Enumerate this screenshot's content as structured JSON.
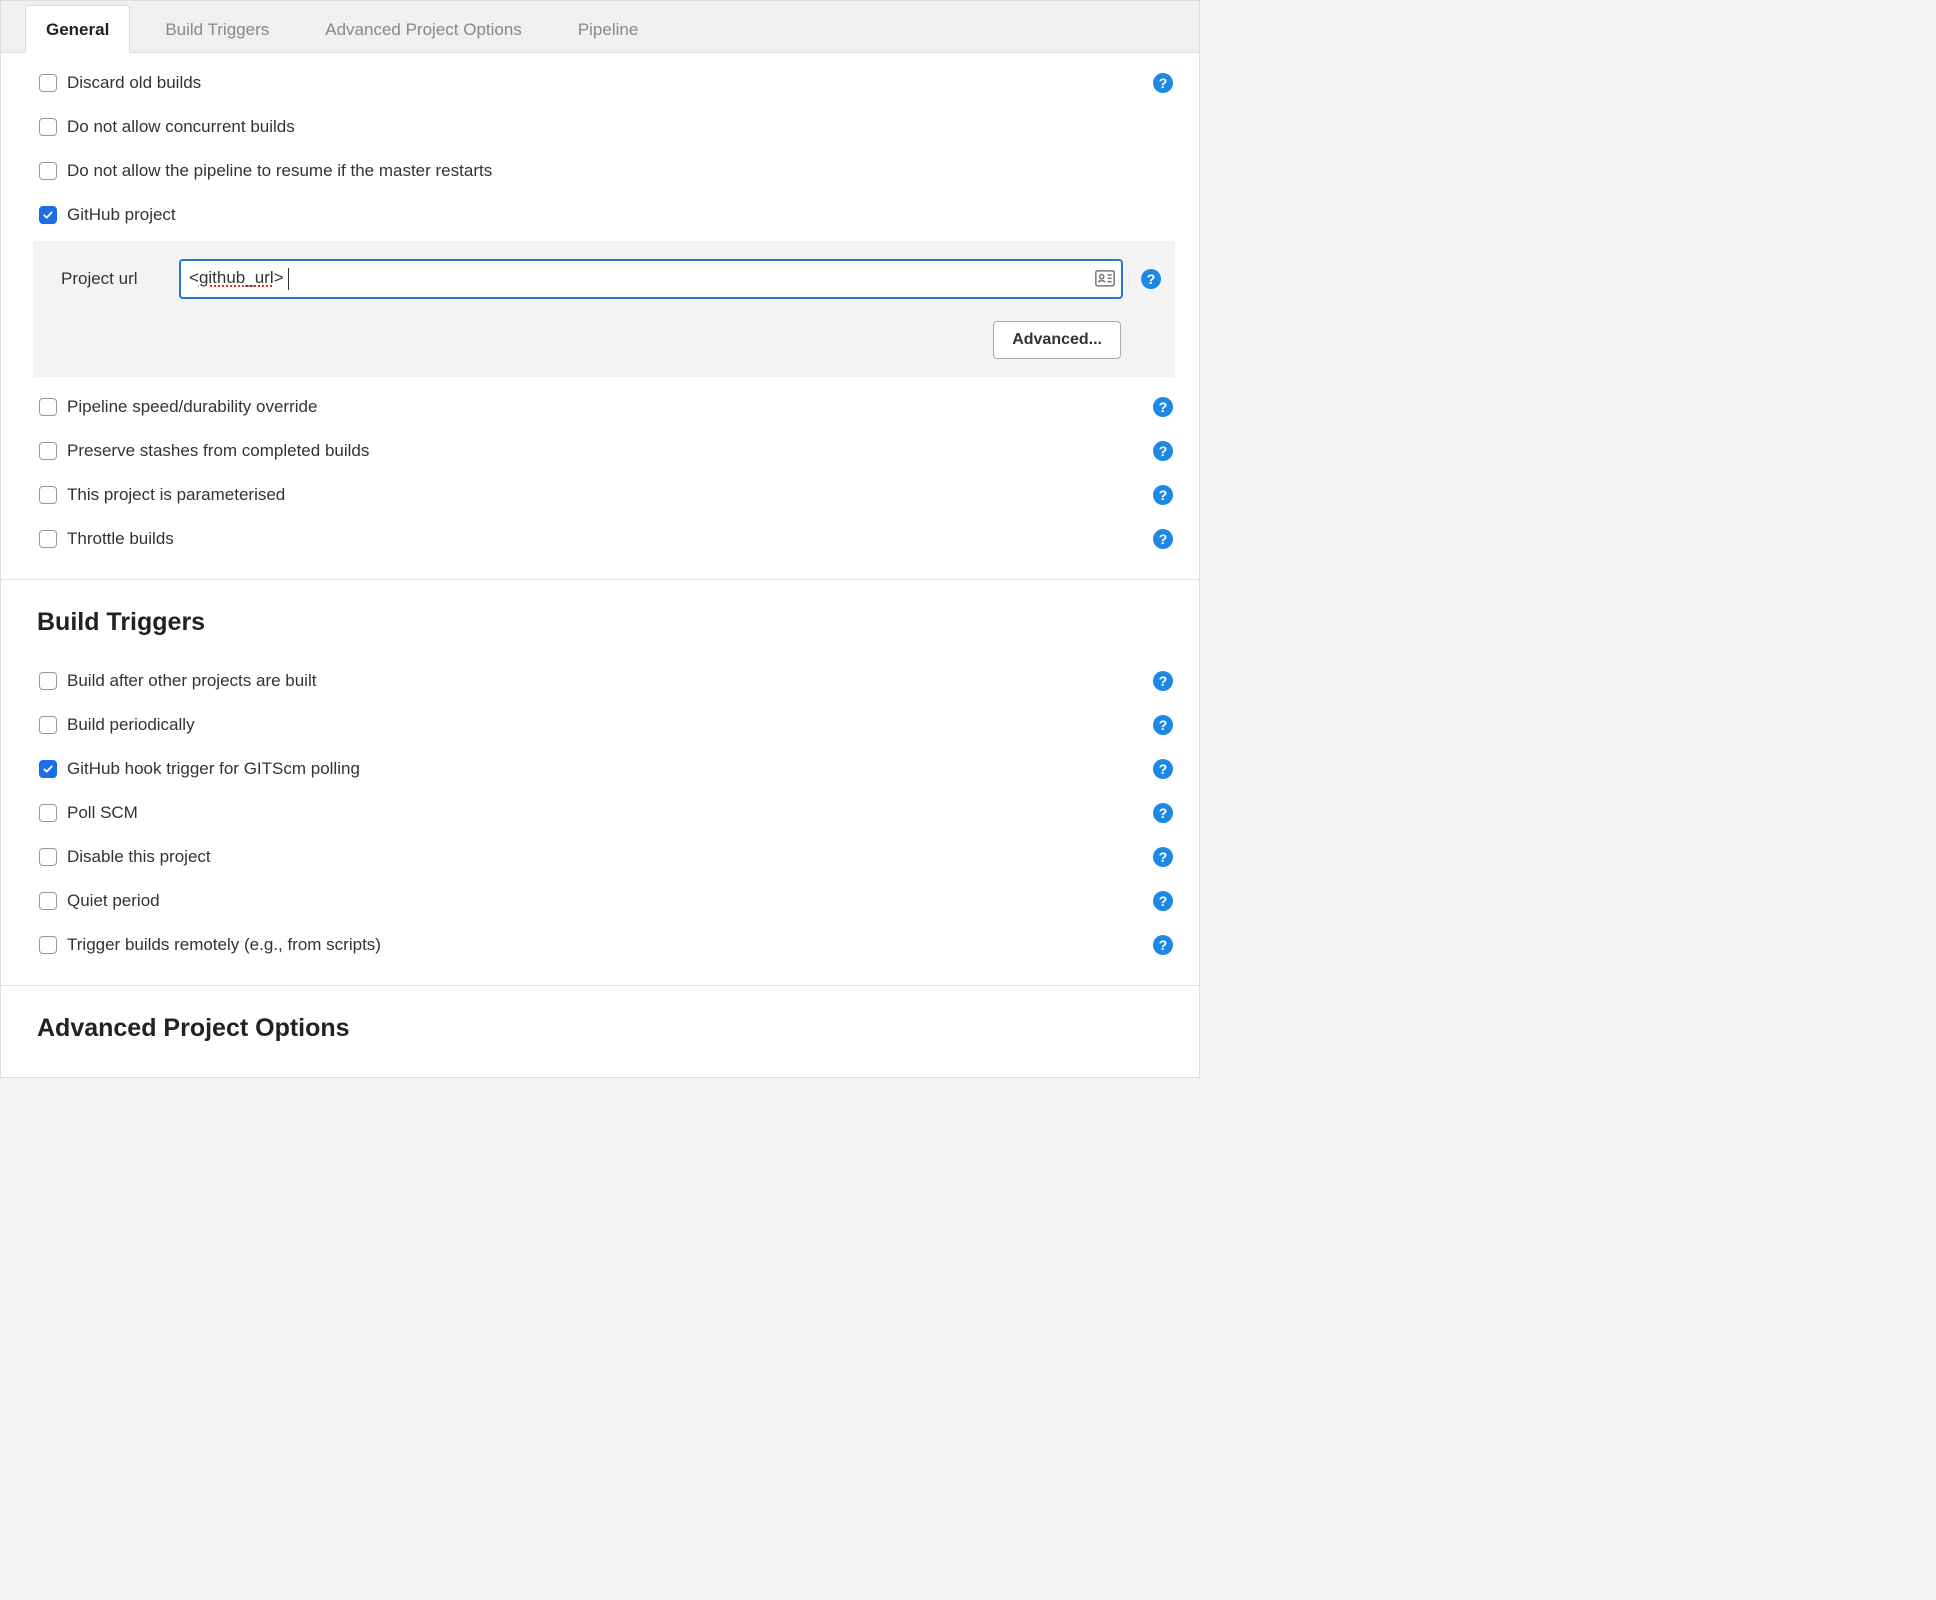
{
  "tabs": [
    {
      "label": "General",
      "active": true
    },
    {
      "label": "Build Triggers",
      "active": false
    },
    {
      "label": "Advanced Project Options",
      "active": false
    },
    {
      "label": "Pipeline",
      "active": false
    }
  ],
  "general": {
    "options": [
      {
        "label": "Discard old builds",
        "checked": false,
        "help": true
      },
      {
        "label": "Do not allow concurrent builds",
        "checked": false,
        "help": false
      },
      {
        "label": "Do not allow the pipeline to resume if the master restarts",
        "checked": false,
        "help": false
      },
      {
        "label": "GitHub project",
        "checked": true,
        "help": false
      }
    ],
    "github": {
      "field_label": "Project url",
      "value": "<github_url>",
      "advanced_label": "Advanced..."
    },
    "options2": [
      {
        "label": "Pipeline speed/durability override",
        "checked": false,
        "help": true
      },
      {
        "label": "Preserve stashes from completed builds",
        "checked": false,
        "help": true
      },
      {
        "label": "This project is parameterised",
        "checked": false,
        "help": true
      },
      {
        "label": "Throttle builds",
        "checked": false,
        "help": true
      }
    ]
  },
  "build_triggers": {
    "title": "Build Triggers",
    "options": [
      {
        "label": "Build after other projects are built",
        "checked": false,
        "help": true
      },
      {
        "label": "Build periodically",
        "checked": false,
        "help": true
      },
      {
        "label": "GitHub hook trigger for GITScm polling",
        "checked": true,
        "help": true
      },
      {
        "label": "Poll SCM",
        "checked": false,
        "help": true
      },
      {
        "label": "Disable this project",
        "checked": false,
        "help": true
      },
      {
        "label": "Quiet period",
        "checked": false,
        "help": true
      },
      {
        "label": "Trigger builds remotely (e.g., from scripts)",
        "checked": false,
        "help": true
      }
    ]
  },
  "advanced_section": {
    "title": "Advanced Project Options"
  },
  "colors": {
    "accent": "#1a6fe8",
    "help": "#1e88e5"
  }
}
